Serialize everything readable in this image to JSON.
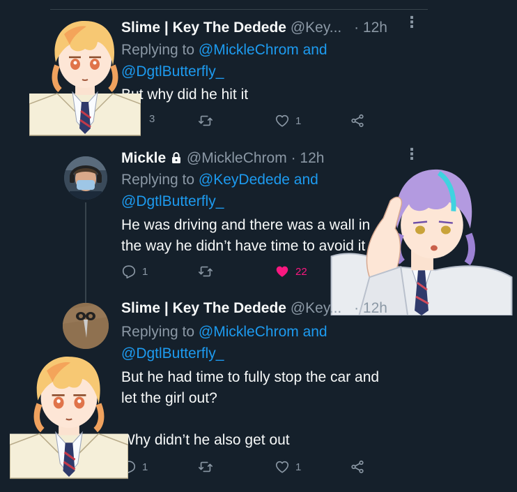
{
  "tweets": [
    {
      "name": "Slime | Key The Dedede",
      "handle": "@Key...",
      "time": "· 12h",
      "replying_prefix": "Replying to",
      "replying_to": "@MickleChrom and",
      "replying_to2": "@DgtlButterfly_",
      "text": "But why did he hit it",
      "replies": "3",
      "retweets": "",
      "likes": "1"
    },
    {
      "name": "Mickle",
      "handle": "@MickleChrom",
      "time": "· 12h",
      "replying_prefix": "Replying to",
      "replying_to": "@KeyDedede and",
      "replying_to2": "@DgtlButterfly_",
      "text": "He was driving and there was a wall in\nthe way he didn’t have time to avoid it",
      "replies": "1",
      "retweets": "",
      "likes": "22"
    },
    {
      "name": "Slime | Key The Dedede",
      "handle": "@Key...",
      "time": "· 12h",
      "replying_prefix": "Replying to",
      "replying_to": "@MickleChrom and",
      "replying_to2": "@DgtlButterfly_",
      "text": "But he had time to fully stop the car and\nlet the girl out?\n\nWhy didn’t he also get out",
      "replies": "1",
      "retweets": "",
      "likes": "1"
    }
  ],
  "colors": {
    "background": "#15202b",
    "text": "#f7f9f9",
    "muted": "#8b98a5",
    "link": "#1d9bf0",
    "like": "#f91880"
  },
  "icons": [
    "reply-icon",
    "retweet-icon",
    "like-icon",
    "share-icon",
    "lock-icon",
    "more-icon"
  ]
}
